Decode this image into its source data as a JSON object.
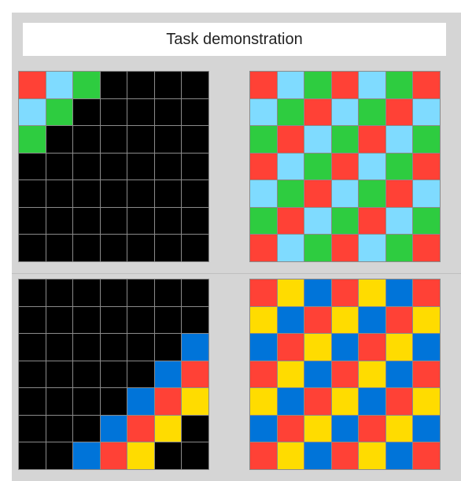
{
  "title": "Task demonstration",
  "palette": {
    "0": "#000000",
    "1": "#ff4136",
    "2": "#7fdbff",
    "3": "#2ecc40",
    "4": "#0074d9",
    "5": "#ffdc00"
  },
  "pairs": [
    {
      "input": [
        [
          1,
          2,
          3,
          0,
          0,
          0,
          0
        ],
        [
          2,
          3,
          0,
          0,
          0,
          0,
          0
        ],
        [
          3,
          0,
          0,
          0,
          0,
          0,
          0
        ],
        [
          0,
          0,
          0,
          0,
          0,
          0,
          0
        ],
        [
          0,
          0,
          0,
          0,
          0,
          0,
          0
        ],
        [
          0,
          0,
          0,
          0,
          0,
          0,
          0
        ],
        [
          0,
          0,
          0,
          0,
          0,
          0,
          0
        ]
      ],
      "output": [
        [
          1,
          2,
          3,
          1,
          2,
          3,
          1
        ],
        [
          2,
          3,
          1,
          2,
          3,
          1,
          2
        ],
        [
          3,
          1,
          2,
          3,
          1,
          2,
          3
        ],
        [
          1,
          2,
          3,
          1,
          2,
          3,
          1
        ],
        [
          2,
          3,
          1,
          2,
          3,
          1,
          2
        ],
        [
          3,
          1,
          2,
          3,
          1,
          2,
          3
        ],
        [
          1,
          2,
          3,
          1,
          2,
          3,
          1
        ]
      ]
    },
    {
      "input": [
        [
          0,
          0,
          0,
          0,
          0,
          0,
          0
        ],
        [
          0,
          0,
          0,
          0,
          0,
          0,
          0
        ],
        [
          0,
          0,
          0,
          0,
          0,
          0,
          4
        ],
        [
          0,
          0,
          0,
          0,
          0,
          4,
          1
        ],
        [
          0,
          0,
          0,
          0,
          4,
          1,
          5
        ],
        [
          0,
          0,
          0,
          4,
          1,
          5,
          0
        ],
        [
          0,
          0,
          4,
          1,
          5,
          0,
          0
        ]
      ],
      "output": [
        [
          1,
          5,
          4,
          1,
          5,
          4,
          1
        ],
        [
          5,
          4,
          1,
          5,
          4,
          1,
          5
        ],
        [
          4,
          1,
          5,
          4,
          1,
          5,
          4
        ],
        [
          1,
          5,
          4,
          1,
          5,
          4,
          1
        ],
        [
          5,
          4,
          1,
          5,
          4,
          1,
          5
        ],
        [
          4,
          1,
          5,
          4,
          1,
          5,
          4
        ],
        [
          1,
          5,
          4,
          1,
          5,
          4,
          1
        ]
      ]
    }
  ]
}
